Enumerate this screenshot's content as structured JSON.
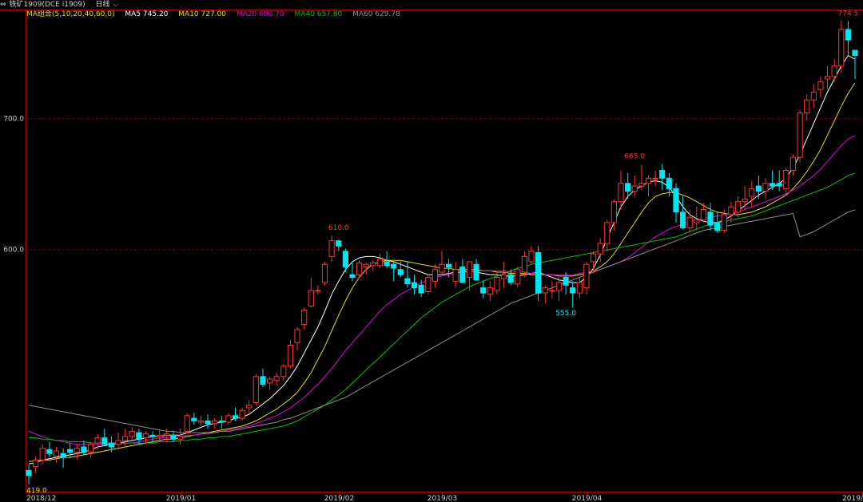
{
  "header": {
    "instrument": "铁矿1909(DCE i1909)",
    "period": "日线",
    "period_arrow": "⌵"
  },
  "ma_legend": {
    "combo": "MA组合(5,10,20,40,60,0)",
    "items": [
      {
        "label": "MA5 745.20",
        "color": "#ffffff"
      },
      {
        "label": "MA10 727.00",
        "color": "#e8e000"
      },
      {
        "label": "MA20 686.70",
        "color": "#e000e0"
      },
      {
        "label": "MA40 657.80",
        "color": "#00c000"
      },
      {
        "label": "MA60 629.78",
        "color": "#909090"
      }
    ]
  },
  "colors": {
    "up": "#ff3232",
    "down": "#00e5f0",
    "grid": "#7a0000",
    "axis": "#b00000"
  },
  "chart_data": {
    "type": "candlestick",
    "ylim": [
      415,
      782
    ],
    "y_ticks": [
      {
        "value": 600,
        "label": "600.0"
      },
      {
        "value": 700,
        "label": "700.0"
      }
    ],
    "x_ticks": [
      {
        "index": 0,
        "label": "2018/12"
      },
      {
        "index": 22,
        "label": "2019/01"
      },
      {
        "index": 45,
        "label": "2019/02"
      },
      {
        "index": 60,
        "label": "2019/03"
      },
      {
        "index": 81,
        "label": "2019/04"
      },
      {
        "index": 121,
        "label": "2019/"
      }
    ],
    "annotations": [
      {
        "index": 0,
        "value": 419,
        "label": "419.0",
        "color": "#e8e000",
        "pos": "below"
      },
      {
        "index": 45,
        "value": 610,
        "label": "610.0",
        "color": "#ff3232",
        "pos": "above"
      },
      {
        "index": 78,
        "value": 555,
        "label": "555.0",
        "color": "#00e5f0",
        "pos": "below"
      },
      {
        "index": 88,
        "value": 665,
        "label": "665.0",
        "color": "#ff3232",
        "pos": "above"
      },
      {
        "index": 119,
        "value": 774.5,
        "label": "774.5",
        "color": "#ff3232",
        "pos": "above"
      }
    ],
    "ohlc_columns": [
      "open",
      "high",
      "low",
      "close"
    ],
    "ohlc": [
      [
        430,
        434,
        419,
        426
      ],
      [
        433,
        441,
        428,
        438
      ],
      [
        438,
        450,
        435,
        447
      ],
      [
        446,
        452,
        440,
        443
      ],
      [
        441,
        448,
        436,
        445
      ],
      [
        443,
        447,
        432,
        440
      ],
      [
        446,
        451,
        440,
        444
      ],
      [
        444,
        450,
        438,
        447
      ],
      [
        448,
        453,
        442,
        444
      ],
      [
        444,
        452,
        440,
        450
      ],
      [
        451,
        458,
        446,
        455
      ],
      [
        455,
        462,
        450,
        450
      ],
      [
        451,
        456,
        444,
        448
      ],
      [
        450,
        459,
        446,
        453
      ],
      [
        453,
        462,
        449,
        456
      ],
      [
        456,
        463,
        452,
        460
      ],
      [
        459,
        462,
        450,
        454
      ],
      [
        455,
        460,
        450,
        458
      ],
      [
        457,
        460,
        451,
        456
      ],
      [
        456,
        461,
        452,
        457
      ],
      [
        457,
        462,
        452,
        458
      ],
      [
        457,
        460,
        452,
        454
      ],
      [
        454,
        462,
        450,
        456
      ],
      [
        460,
        474,
        458,
        472
      ],
      [
        470,
        474,
        465,
        468
      ],
      [
        467,
        472,
        464,
        468
      ],
      [
        468,
        473,
        462,
        466
      ],
      [
        466,
        470,
        462,
        468
      ],
      [
        468,
        472,
        462,
        467
      ],
      [
        467,
        474,
        465,
        472
      ],
      [
        472,
        478,
        468,
        470
      ],
      [
        470,
        478,
        468,
        476
      ],
      [
        478,
        484,
        474,
        480
      ],
      [
        482,
        504,
        480,
        502
      ],
      [
        502,
        508,
        494,
        496
      ],
      [
        497,
        502,
        492,
        500
      ],
      [
        499,
        505,
        495,
        502
      ],
      [
        502,
        512,
        499,
        510
      ],
      [
        510,
        530,
        508,
        526
      ],
      [
        528,
        540,
        522,
        538
      ],
      [
        542,
        555,
        538,
        553
      ],
      [
        556,
        578,
        555,
        568
      ],
      [
        568,
        572,
        565,
        568
      ],
      [
        574,
        590,
        572,
        588
      ],
      [
        594,
        610,
        590,
        606
      ],
      [
        606,
        607,
        598,
        602
      ],
      [
        598,
        600,
        582,
        586
      ],
      [
        580,
        590,
        575,
        578
      ],
      [
        580,
        591,
        578,
        589
      ],
      [
        586,
        589,
        580,
        588
      ],
      [
        587,
        591,
        583,
        589
      ],
      [
        587,
        596,
        585,
        592
      ],
      [
        590,
        598,
        585,
        587
      ],
      [
        588,
        590,
        575,
        585
      ],
      [
        584,
        590,
        578,
        580
      ],
      [
        577,
        590,
        570,
        573
      ],
      [
        574,
        580,
        565,
        570
      ],
      [
        572,
        576,
        563,
        566
      ],
      [
        567,
        580,
        565,
        578
      ],
      [
        575,
        588,
        570,
        584
      ],
      [
        582,
        598,
        580,
        588
      ],
      [
        588,
        592,
        578,
        586
      ],
      [
        575,
        590,
        570,
        584
      ],
      [
        586,
        592,
        578,
        574
      ],
      [
        578,
        590,
        568,
        590
      ],
      [
        588,
        592,
        578,
        576
      ],
      [
        570,
        576,
        562,
        566
      ],
      [
        565,
        575,
        560,
        570
      ],
      [
        568,
        582,
        565,
        578
      ],
      [
        577,
        590,
        570,
        580
      ],
      [
        580,
        584,
        572,
        574
      ],
      [
        573,
        586,
        570,
        584
      ],
      [
        582,
        598,
        578,
        594
      ],
      [
        590,
        602,
        588,
        598
      ],
      [
        597,
        602,
        560,
        566
      ],
      [
        566,
        572,
        558,
        570
      ],
      [
        568,
        575,
        562,
        568
      ],
      [
        568,
        578,
        560,
        574
      ],
      [
        578,
        582,
        565,
        572
      ],
      [
        570,
        575,
        555,
        566
      ],
      [
        566,
        578,
        562,
        574
      ],
      [
        570,
        590,
        565,
        588
      ],
      [
        590,
        598,
        582,
        596
      ],
      [
        596,
        608,
        590,
        604
      ],
      [
        604,
        622,
        598,
        620
      ],
      [
        620,
        638,
        614,
        636
      ],
      [
        636,
        660,
        630,
        650
      ],
      [
        650,
        658,
        638,
        644
      ],
      [
        644,
        656,
        640,
        648
      ],
      [
        648,
        664,
        645,
        650
      ],
      [
        650,
        656,
        640,
        654
      ],
      [
        654,
        660,
        648,
        654
      ],
      [
        660,
        665,
        645,
        654
      ],
      [
        654,
        658,
        640,
        646
      ],
      [
        646,
        650,
        620,
        628
      ],
      [
        628,
        640,
        615,
        616
      ],
      [
        616,
        630,
        612,
        624
      ],
      [
        620,
        632,
        614,
        622
      ],
      [
        622,
        635,
        620,
        630
      ],
      [
        628,
        635,
        614,
        618
      ],
      [
        620,
        628,
        612,
        614
      ],
      [
        614,
        630,
        612,
        626
      ],
      [
        626,
        636,
        620,
        632
      ],
      [
        628,
        640,
        624,
        636
      ],
      [
        636,
        648,
        630,
        638
      ],
      [
        640,
        652,
        632,
        646
      ],
      [
        648,
        656,
        638,
        644
      ],
      [
        644,
        654,
        638,
        650
      ],
      [
        650,
        660,
        645,
        648
      ],
      [
        650,
        660,
        644,
        648
      ],
      [
        646,
        662,
        642,
        660
      ],
      [
        660,
        672,
        656,
        670
      ],
      [
        670,
        706,
        666,
        704
      ],
      [
        704,
        718,
        698,
        714
      ],
      [
        714,
        726,
        708,
        720
      ],
      [
        722,
        732,
        716,
        728
      ],
      [
        730,
        740,
        722,
        732
      ],
      [
        732,
        745,
        728,
        740
      ],
      [
        740,
        775,
        735,
        768
      ],
      [
        768,
        774.5,
        748,
        760
      ],
      [
        752,
        752,
        730,
        748
      ]
    ],
    "series": [
      {
        "name": "MA5",
        "color": "#ffffff",
        "values": [
          435,
          436,
          438,
          439,
          440,
          441,
          442,
          443,
          444,
          446,
          448,
          449,
          450,
          451,
          452,
          453,
          454,
          455,
          456,
          456,
          457,
          457,
          457,
          459,
          461,
          463,
          465,
          466,
          467,
          468,
          470,
          471,
          473,
          477,
          481,
          485,
          490,
          495,
          502,
          510,
          520,
          530,
          540,
          552,
          565,
          575,
          584,
          590,
          593,
          594,
          594,
          593,
          591,
          590,
          588,
          586,
          584,
          582,
          580,
          580,
          580,
          581,
          582,
          582,
          583,
          582,
          581,
          580,
          580,
          579,
          579,
          579,
          580,
          581,
          582,
          580,
          578,
          576,
          575,
          574,
          574,
          578,
          585,
          595,
          608,
          620,
          632,
          640,
          645,
          648,
          651,
          652,
          651,
          647,
          640,
          632,
          626,
          623,
          621,
          620,
          620,
          622,
          625,
          629,
          633,
          637,
          641,
          644,
          647,
          650,
          654,
          662,
          672,
          684,
          696,
          708,
          720,
          730,
          740,
          748,
          745.2
        ]
      },
      {
        "name": "MA10",
        "color": "#e8e000",
        "values": [
          437,
          437,
          438,
          438,
          439,
          440,
          440,
          441,
          442,
          443,
          444,
          445,
          446,
          447,
          448,
          449,
          450,
          451,
          452,
          453,
          454,
          454,
          455,
          456,
          457,
          458,
          459,
          460,
          461,
          462,
          463,
          464,
          466,
          468,
          471,
          474,
          477,
          481,
          485,
          490,
          497,
          505,
          515,
          525,
          537,
          549,
          560,
          570,
          578,
          584,
          588,
          590,
          591,
          591,
          591,
          590,
          589,
          588,
          587,
          586,
          585,
          585,
          584,
          584,
          584,
          584,
          583,
          583,
          582,
          582,
          581,
          581,
          581,
          580,
          580,
          580,
          580,
          579,
          579,
          579,
          580,
          581,
          583,
          586,
          590,
          596,
          604,
          612,
          620,
          628,
          635,
          640,
          642,
          643,
          643,
          641,
          639,
          636,
          633,
          630,
          628,
          627,
          626,
          626,
          627,
          628,
          630,
          632,
          635,
          638,
          641,
          646,
          652,
          659,
          667,
          676,
          687,
          698,
          709,
          719,
          727
        ]
      },
      {
        "name": "MA20",
        "color": "#e000e0",
        "values": [
          460,
          458,
          456,
          454,
          453,
          452,
          451,
          450,
          450,
          450,
          450,
          450,
          450,
          450,
          451,
          451,
          452,
          453,
          454,
          455,
          455,
          456,
          456,
          457,
          457,
          458,
          458,
          459,
          460,
          461,
          462,
          463,
          464,
          466,
          468,
          470,
          472,
          475,
          478,
          482,
          486,
          491,
          496,
          502,
          508,
          515,
          522,
          528,
          534,
          540,
          546,
          552,
          557,
          561,
          565,
          568,
          571,
          574,
          576,
          578,
          579,
          580,
          581,
          582,
          582,
          583,
          583,
          583,
          583,
          583,
          582,
          582,
          582,
          581,
          581,
          580,
          580,
          580,
          580,
          580,
          581,
          582,
          583,
          584,
          586,
          588,
          590,
          593,
          597,
          601,
          605,
          609,
          612,
          615,
          617,
          619,
          621,
          622,
          623,
          624,
          625,
          626,
          627,
          628,
          630,
          632,
          634,
          636,
          638,
          640,
          642,
          645,
          648,
          652,
          656,
          661,
          667,
          673,
          679,
          684,
          686.7
        ]
      },
      {
        "name": "MA40",
        "color": "#00c000",
        "values": [
          455,
          455,
          454,
          454,
          453,
          453,
          452,
          452,
          452,
          451,
          451,
          451,
          451,
          451,
          451,
          451,
          451,
          451,
          451,
          452,
          452,
          452,
          453,
          453,
          454,
          454,
          455,
          455,
          456,
          456,
          457,
          458,
          459,
          460,
          461,
          462,
          463,
          464,
          466,
          468,
          471,
          474,
          477,
          480,
          484,
          488,
          492,
          497,
          502,
          507,
          512,
          517,
          522,
          527,
          532,
          537,
          542,
          547,
          551,
          555,
          559,
          562,
          565,
          568,
          571,
          573,
          575,
          577,
          579,
          581,
          583,
          585,
          586,
          588,
          589,
          590,
          591,
          592,
          593,
          594,
          595,
          596,
          597,
          598,
          599,
          600,
          601,
          602,
          603,
          604,
          605,
          606,
          607,
          608,
          609,
          611,
          613,
          615,
          617,
          619,
          620,
          621,
          622,
          623,
          624,
          625,
          627,
          629,
          631,
          633,
          635,
          637,
          639,
          641,
          643,
          645,
          647,
          650,
          653,
          656,
          657.8
        ]
      },
      {
        "name": "MA60",
        "color": "#909090",
        "values": [
          480,
          479,
          478,
          477,
          476,
          475,
          474,
          473,
          472,
          471,
          470,
          469,
          468,
          467,
          466,
          465,
          464,
          463,
          462,
          461,
          460,
          460,
          459,
          459,
          459,
          459,
          459,
          459,
          460,
          460,
          461,
          462,
          463,
          464,
          465,
          466,
          467,
          469,
          470,
          472,
          474,
          476,
          478,
          480,
          482,
          484,
          486,
          489,
          492,
          495,
          498,
          501,
          504,
          507,
          510,
          513,
          516,
          519,
          522,
          525,
          528,
          531,
          534,
          537,
          540,
          543,
          546,
          549,
          552,
          555,
          558,
          560,
          562,
          564,
          566,
          568,
          570,
          572,
          574,
          576,
          578,
          580,
          582,
          584,
          586,
          588,
          590,
          592,
          594,
          596,
          598,
          600,
          602,
          604,
          606,
          608,
          610,
          612,
          614,
          615,
          616,
          617,
          618,
          619,
          620,
          621,
          622,
          623,
          624,
          625,
          626,
          627,
          609,
          611,
          613,
          616,
          619,
          622,
          625,
          628,
          629.78
        ]
      }
    ]
  }
}
